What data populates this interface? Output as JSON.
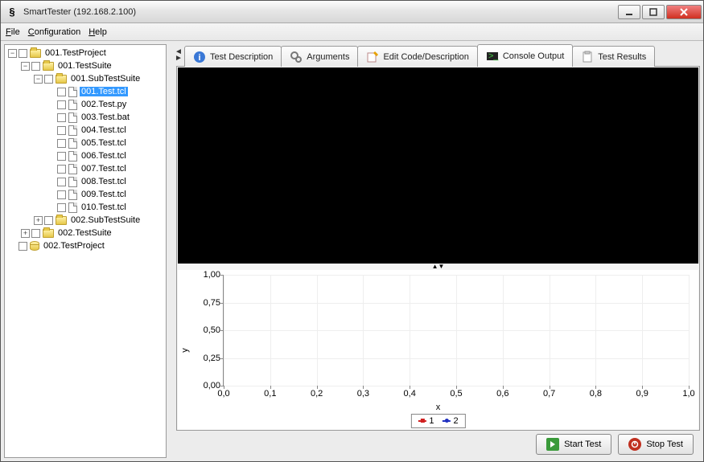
{
  "window": {
    "title": "SmartTester (192.168.2.100)"
  },
  "menu": {
    "file": "File",
    "config": "Configuration",
    "help": "Help"
  },
  "tree": {
    "n0": "001.TestProject",
    "n1": "001.TestSuite",
    "n2": "001.SubTestSuite",
    "f": [
      "001.Test.tcl",
      "002.Test.py",
      "003.Test.bat",
      "004.Test.tcl",
      "005.Test.tcl",
      "006.Test.tcl",
      "007.Test.tcl",
      "008.Test.tcl",
      "009.Test.tcl",
      "010.Test.tcl"
    ],
    "n3": "002.SubTestSuite",
    "n4": "002.TestSuite",
    "n5": "002.TestProject"
  },
  "tabs": {
    "desc": "Test Description",
    "args": "Arguments",
    "edit": "Edit Code/Description",
    "console": "Console Output",
    "results": "Test Results"
  },
  "chart_data": {
    "type": "line",
    "title": "",
    "xlabel": "x",
    "ylabel": "y",
    "xlim": [
      0.0,
      1.0
    ],
    "ylim": [
      0.0,
      1.0
    ],
    "xticks": [
      0.0,
      0.1,
      0.2,
      0.3,
      0.4,
      0.5,
      0.6,
      0.7,
      0.8,
      0.9,
      1.0
    ],
    "yticks": [
      0.0,
      0.25,
      0.5,
      0.75,
      1.0
    ],
    "xtick_labels": [
      "0,0",
      "0,1",
      "0,2",
      "0,3",
      "0,4",
      "0,5",
      "0,6",
      "0,7",
      "0,8",
      "0,9",
      "1,0"
    ],
    "ytick_labels": [
      "0,00",
      "0,25",
      "0,50",
      "0,75",
      "1,00"
    ],
    "series": [
      {
        "name": "1",
        "values": []
      },
      {
        "name": "2",
        "values": []
      }
    ]
  },
  "buttons": {
    "start": "Start Test",
    "stop": "Stop Test"
  }
}
